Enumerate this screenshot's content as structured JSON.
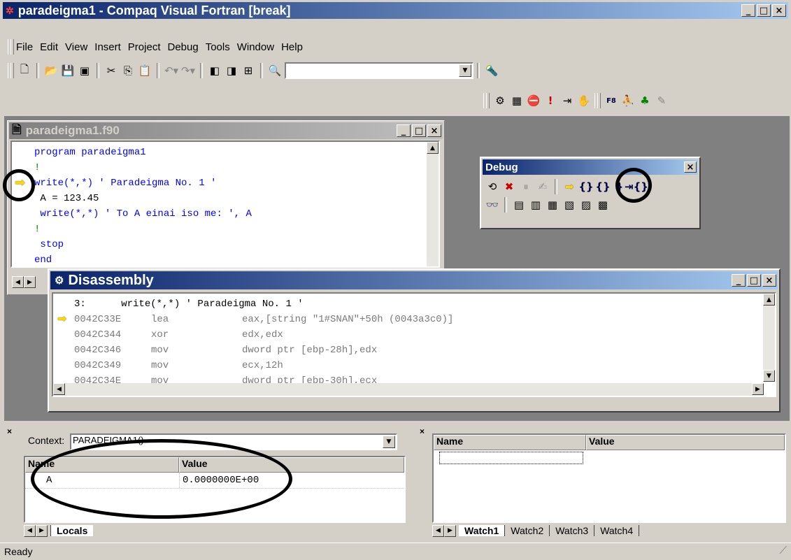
{
  "window": {
    "title": "paradeigma1 - Compaq Visual Fortran [break]"
  },
  "menu": [
    "File",
    "Edit",
    "View",
    "Insert",
    "Project",
    "Debug",
    "Tools",
    "Window",
    "Help"
  ],
  "toolbar": {
    "find_value": ""
  },
  "editor": {
    "title": "paradeigma1.f90",
    "lines": [
      {
        "text": "program paradeigma1",
        "kind": "kw"
      },
      {
        "text": "!",
        "kind": "comment"
      },
      {
        "text": "write(*,*) ' Paradeigma No. 1 '",
        "kind": "kw"
      },
      {
        "text": " A = 123.45",
        "kind": "plain"
      },
      {
        "text": " write(*,*) ' To A einai iso me: ', A",
        "kind": "kw"
      },
      {
        "text": "!",
        "kind": "comment"
      },
      {
        "text": " stop",
        "kind": "kw"
      },
      {
        "text": "end",
        "kind": "kw"
      }
    ]
  },
  "debug_toolbar": {
    "title": "Debug"
  },
  "disassembly": {
    "title": "Disassembly",
    "source_line": "3:      write(*,*) ' Paradeigma No. 1 '",
    "rows": [
      {
        "addr": "0042C33E",
        "op": "lea",
        "args": "eax,[string \"1#SNAN\"+50h (0043a3c0)]"
      },
      {
        "addr": "0042C344",
        "op": "xor",
        "args": "edx,edx"
      },
      {
        "addr": "0042C346",
        "op": "mov",
        "args": "dword ptr [ebp-28h],edx"
      },
      {
        "addr": "0042C349",
        "op": "mov",
        "args": "ecx,12h"
      },
      {
        "addr": "0042C34E",
        "op": "mov",
        "args": "dword ptr [ebp-30h],ecx"
      }
    ]
  },
  "locals": {
    "context_label": "Context:",
    "context_value": "PARADEIGMA1()",
    "col_name": "Name",
    "col_value": "Value",
    "rows": [
      {
        "name": "A",
        "value": "0.0000000E+00"
      }
    ],
    "tab": "Locals"
  },
  "watch": {
    "col_name": "Name",
    "col_value": "Value",
    "tabs": [
      "Watch1",
      "Watch2",
      "Watch3",
      "Watch4"
    ]
  },
  "status": {
    "text": "Ready"
  }
}
